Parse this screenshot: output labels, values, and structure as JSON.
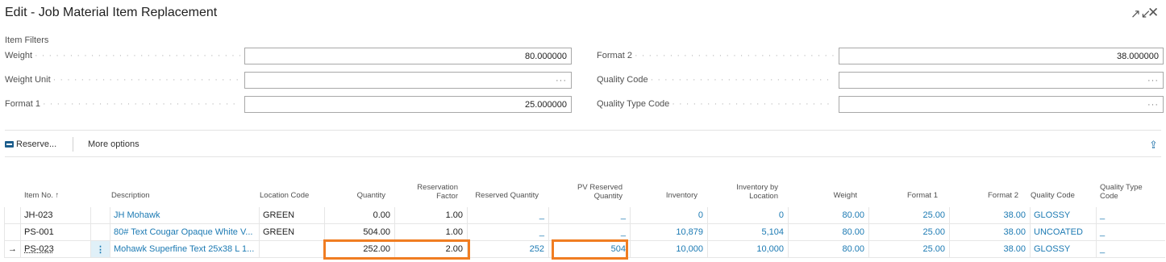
{
  "window": {
    "title": "Edit - Job Material Item Replacement",
    "collapse_icon": "↗↙",
    "close_icon": "✕"
  },
  "filters": {
    "group_title": "Item Filters",
    "left": [
      {
        "label": "Weight",
        "value": "80.000000"
      },
      {
        "label": "Weight Unit",
        "value": "···"
      },
      {
        "label": "Format 1",
        "value": "25.000000"
      }
    ],
    "right": [
      {
        "label": "Format 2",
        "value": "38.000000"
      },
      {
        "label": "Quality Code",
        "value": "···"
      },
      {
        "label": "Quality Type Code",
        "value": "···"
      }
    ]
  },
  "actions": {
    "reserve": "Reserve...",
    "more": "More options",
    "share_icon": "⇪"
  },
  "columns": {
    "item_no": "Item No. ↑",
    "description": "Description",
    "location": "Location Code",
    "quantity": "Quantity",
    "res_factor_1": "Reservation",
    "res_factor_2": "Factor",
    "reserved_qty": "Reserved Quantity",
    "pv_reserved_1": "PV Reserved",
    "pv_reserved_2": "Quantity",
    "inventory": "Inventory",
    "inv_loc_1": "Inventory by",
    "inv_loc_2": "Location",
    "weight": "Weight",
    "format1": "Format 1",
    "format2": "Format 2",
    "quality": "Quality Code",
    "quality_type_1": "Quality Type",
    "quality_type_2": "Code"
  },
  "rows": [
    {
      "arrow": "",
      "menu": "",
      "item_no": "JH-023",
      "description": "JH Mohawk",
      "location": "GREEN",
      "quantity": "0.00",
      "res_factor": "1.00",
      "reserved_qty": "_",
      "pv_reserved": "_",
      "inventory": "0",
      "inv_loc": "0",
      "weight": "80.00",
      "format1": "25.00",
      "format2": "38.00",
      "quality": "GLOSSY",
      "quality_type": "_"
    },
    {
      "arrow": "",
      "menu": "",
      "item_no": "PS-001",
      "description": "80# Text Cougar Opaque White V...",
      "location": "GREEN",
      "quantity": "504.00",
      "res_factor": "1.00",
      "reserved_qty": "_",
      "pv_reserved": "_",
      "inventory": "10,879",
      "inv_loc": "5,104",
      "weight": "80.00",
      "format1": "25.00",
      "format2": "38.00",
      "quality": "UNCOATED",
      "quality_type": "_"
    },
    {
      "arrow": "→",
      "menu": "⋮",
      "item_no": "PS-023",
      "description": "Mohawk Superfine Text 25x38 L 1...",
      "location": "",
      "quantity": "252.00",
      "res_factor": "2.00",
      "reserved_qty": "252",
      "pv_reserved": "504",
      "inventory": "10,000",
      "inv_loc": "10,000",
      "weight": "80.00",
      "format1": "25.00",
      "format2": "38.00",
      "quality": "GLOSSY",
      "quality_type": "_"
    }
  ]
}
